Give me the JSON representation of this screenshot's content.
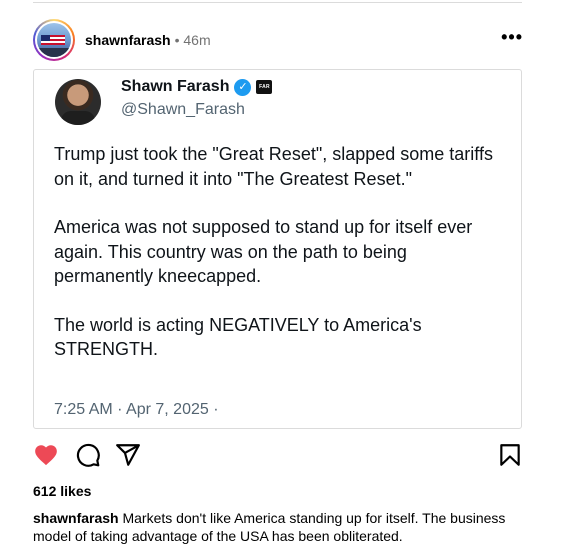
{
  "post": {
    "username": "shawnfarash",
    "separator": "•",
    "time": "46m",
    "more": "•••"
  },
  "tweet": {
    "name": "Shawn Farash",
    "verified_mark": "✓",
    "affiliate": "FAR",
    "handle": "@Shawn_Farash",
    "paragraphs": [
      "Trump just took the \"Great Reset\", slapped some tariffs on it, and turned it into \"The Greatest Reset.\"",
      "America was not supposed to stand up for itself ever again. This country was on the path to being permanently kneecapped.",
      "The world is acting NEGATIVELY to America's STRENGTH."
    ],
    "timestamp": "7:25 AM · Apr 7, 2025 ·"
  },
  "actions": {
    "heart_color": "#ed4956",
    "icons": [
      "heart-icon",
      "comment-icon",
      "share-icon",
      "save-icon"
    ]
  },
  "likes": "612 likes",
  "caption": {
    "username": "shawnfarash",
    "text": "Markets don't like America standing up for itself. The business model of taking advantage of the USA has been obliterated."
  }
}
